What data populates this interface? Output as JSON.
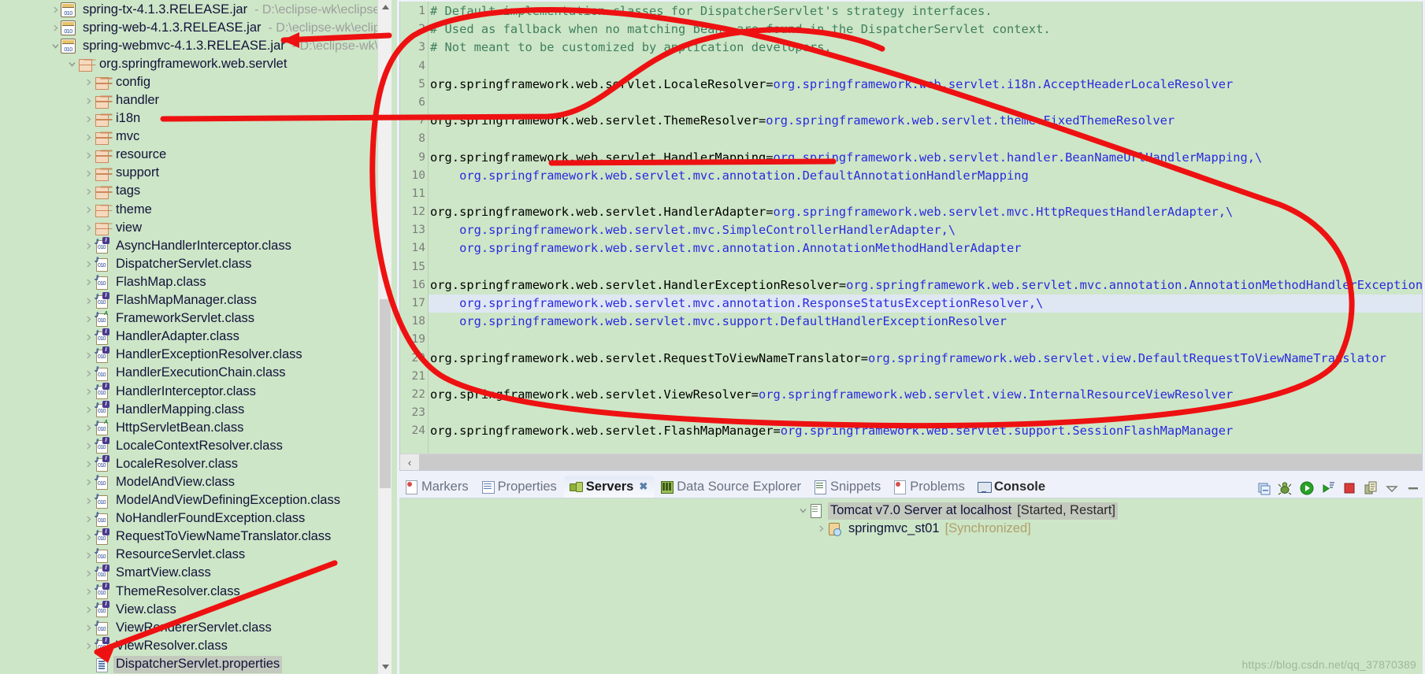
{
  "explorer": {
    "name": "package-explorer",
    "items": [
      {
        "indent": 1,
        "twisty": "collapsed",
        "icon": "jar-icon",
        "label": "spring-tx-4.1.3.RELEASE.jar",
        "path": "- D:\\eclipse-wk\\eclipse-c"
      },
      {
        "indent": 1,
        "twisty": "collapsed",
        "icon": "jar-icon",
        "label": "spring-web-4.1.3.RELEASE.jar",
        "path": "- D:\\eclipse-wk\\eclipse"
      },
      {
        "indent": 1,
        "twisty": "expanded",
        "icon": "jar-icon",
        "label": "spring-webmvc-4.1.3.RELEASE.jar",
        "path": "- D:\\eclipse-wk\\ec"
      },
      {
        "indent": 2,
        "twisty": "expanded",
        "icon": "package-icon",
        "label": "org.springframework.web.servlet",
        "path": ""
      },
      {
        "indent": 3,
        "twisty": "collapsed",
        "icon": "package-icon",
        "label": "config",
        "path": ""
      },
      {
        "indent": 3,
        "twisty": "collapsed",
        "icon": "package-icon",
        "label": "handler",
        "path": ""
      },
      {
        "indent": 3,
        "twisty": "collapsed",
        "icon": "package-icon",
        "label": "i18n",
        "path": ""
      },
      {
        "indent": 3,
        "twisty": "collapsed",
        "icon": "package-icon",
        "label": "mvc",
        "path": ""
      },
      {
        "indent": 3,
        "twisty": "collapsed",
        "icon": "package-icon",
        "label": "resource",
        "path": ""
      },
      {
        "indent": 3,
        "twisty": "collapsed",
        "icon": "package-icon",
        "label": "support",
        "path": ""
      },
      {
        "indent": 3,
        "twisty": "collapsed",
        "icon": "package-icon",
        "label": "tags",
        "path": ""
      },
      {
        "indent": 3,
        "twisty": "collapsed",
        "icon": "package-icon",
        "label": "theme",
        "path": ""
      },
      {
        "indent": 3,
        "twisty": "collapsed",
        "icon": "package-icon",
        "label": "view",
        "path": ""
      },
      {
        "indent": 3,
        "twisty": "collapsed",
        "icon": "interface-class-icon",
        "label": "AsyncHandlerInterceptor.class",
        "path": ""
      },
      {
        "indent": 3,
        "twisty": "collapsed",
        "icon": "class-icon",
        "label": "DispatcherServlet.class",
        "path": ""
      },
      {
        "indent": 3,
        "twisty": "collapsed",
        "icon": "class-icon",
        "label": "FlashMap.class",
        "path": ""
      },
      {
        "indent": 3,
        "twisty": "collapsed",
        "icon": "interface-class-icon",
        "label": "FlashMapManager.class",
        "path": ""
      },
      {
        "indent": 3,
        "twisty": "collapsed",
        "icon": "abstract-class-icon",
        "label": "FrameworkServlet.class",
        "path": ""
      },
      {
        "indent": 3,
        "twisty": "collapsed",
        "icon": "interface-class-icon",
        "label": "HandlerAdapter.class",
        "path": ""
      },
      {
        "indent": 3,
        "twisty": "collapsed",
        "icon": "interface-class-icon",
        "label": "HandlerExceptionResolver.class",
        "path": ""
      },
      {
        "indent": 3,
        "twisty": "collapsed",
        "icon": "class-icon",
        "label": "HandlerExecutionChain.class",
        "path": ""
      },
      {
        "indent": 3,
        "twisty": "collapsed",
        "icon": "interface-class-icon",
        "label": "HandlerInterceptor.class",
        "path": ""
      },
      {
        "indent": 3,
        "twisty": "collapsed",
        "icon": "interface-class-icon",
        "label": "HandlerMapping.class",
        "path": ""
      },
      {
        "indent": 3,
        "twisty": "collapsed",
        "icon": "abstract-class-icon",
        "label": "HttpServletBean.class",
        "path": ""
      },
      {
        "indent": 3,
        "twisty": "collapsed",
        "icon": "interface-class-icon",
        "label": "LocaleContextResolver.class",
        "path": ""
      },
      {
        "indent": 3,
        "twisty": "collapsed",
        "icon": "interface-class-icon",
        "label": "LocaleResolver.class",
        "path": ""
      },
      {
        "indent": 3,
        "twisty": "collapsed",
        "icon": "class-icon",
        "label": "ModelAndView.class",
        "path": ""
      },
      {
        "indent": 3,
        "twisty": "collapsed",
        "icon": "class-icon",
        "label": "ModelAndViewDefiningException.class",
        "path": ""
      },
      {
        "indent": 3,
        "twisty": "collapsed",
        "icon": "class-icon",
        "label": "NoHandlerFoundException.class",
        "path": ""
      },
      {
        "indent": 3,
        "twisty": "collapsed",
        "icon": "interface-class-icon",
        "label": "RequestToViewNameTranslator.class",
        "path": ""
      },
      {
        "indent": 3,
        "twisty": "collapsed",
        "icon": "class-icon",
        "label": "ResourceServlet.class",
        "path": ""
      },
      {
        "indent": 3,
        "twisty": "collapsed",
        "icon": "interface-class-icon",
        "label": "SmartView.class",
        "path": ""
      },
      {
        "indent": 3,
        "twisty": "collapsed",
        "icon": "interface-class-icon",
        "label": "ThemeResolver.class",
        "path": ""
      },
      {
        "indent": 3,
        "twisty": "collapsed",
        "icon": "interface-class-icon",
        "label": "View.class",
        "path": ""
      },
      {
        "indent": 3,
        "twisty": "collapsed",
        "icon": "class-icon",
        "label": "ViewRendererServlet.class",
        "path": ""
      },
      {
        "indent": 3,
        "twisty": "collapsed",
        "icon": "interface-class-icon",
        "label": "ViewResolver.class",
        "path": ""
      },
      {
        "indent": 3,
        "twisty": "none",
        "icon": "properties-file-icon",
        "label": "DispatcherServlet.properties",
        "path": "",
        "selected": true
      }
    ]
  },
  "editor": {
    "name": "dispatcherservlet-properties-editor",
    "highlighted_line": 17,
    "lines": [
      {
        "n": 1,
        "segments": [
          {
            "t": "# Default implementation classes for DispatcherServlet's strategy interfaces.",
            "c": "cmt"
          }
        ]
      },
      {
        "n": 2,
        "segments": [
          {
            "t": "# Used as fallback when no matching beans are found in the DispatcherServlet context.",
            "c": "cmt"
          }
        ]
      },
      {
        "n": 3,
        "segments": [
          {
            "t": "# Not meant to be customized by application developers.",
            "c": "cmt"
          }
        ]
      },
      {
        "n": 4,
        "segments": []
      },
      {
        "n": 5,
        "segments": [
          {
            "t": "org.springframework.web.servlet.LocaleResolver=",
            "c": "key"
          },
          {
            "t": "org.springframework.web.servlet.i18n.AcceptHeaderLocaleResolver",
            "c": "val"
          }
        ]
      },
      {
        "n": 6,
        "segments": []
      },
      {
        "n": 7,
        "segments": [
          {
            "t": "org.springframework.web.servlet.ThemeResolver=",
            "c": "key"
          },
          {
            "t": "org.springframework.web.servlet.theme.FixedThemeResolver",
            "c": "val"
          }
        ]
      },
      {
        "n": 8,
        "segments": []
      },
      {
        "n": 9,
        "segments": [
          {
            "t": "org.springframework.web.servlet.HandlerMapping=",
            "c": "key"
          },
          {
            "t": "org.springframework.web.servlet.handler.BeanNameUrlHandlerMapping,\\",
            "c": "val"
          }
        ]
      },
      {
        "n": 10,
        "segments": [
          {
            "t": "    org.springframework.web.servlet.mvc.annotation.DefaultAnnotationHandlerMapping",
            "c": "val"
          }
        ]
      },
      {
        "n": 11,
        "segments": []
      },
      {
        "n": 12,
        "segments": [
          {
            "t": "org.springframework.web.servlet.HandlerAdapter=",
            "c": "key"
          },
          {
            "t": "org.springframework.web.servlet.mvc.HttpRequestHandlerAdapter,\\",
            "c": "val"
          }
        ]
      },
      {
        "n": 13,
        "segments": [
          {
            "t": "    org.springframework.web.servlet.mvc.SimpleControllerHandlerAdapter,\\",
            "c": "val"
          }
        ]
      },
      {
        "n": 14,
        "segments": [
          {
            "t": "    org.springframework.web.servlet.mvc.annotation.AnnotationMethodHandlerAdapter",
            "c": "val"
          }
        ]
      },
      {
        "n": 15,
        "segments": []
      },
      {
        "n": 16,
        "segments": [
          {
            "t": "org.springframework.web.servlet.HandlerExceptionResolver=",
            "c": "key"
          },
          {
            "t": "org.springframework.web.servlet.mvc.annotation.AnnotationMethodHandlerExceptionResolver,\\",
            "c": "val"
          }
        ]
      },
      {
        "n": 17,
        "segments": [
          {
            "t": "    org.springframework.web.servlet.mvc.annotation.ResponseStatusExceptionResolver,\\",
            "c": "val"
          }
        ]
      },
      {
        "n": 18,
        "segments": [
          {
            "t": "    org.springframework.web.servlet.mvc.support.DefaultHandlerExceptionResolver",
            "c": "val"
          }
        ]
      },
      {
        "n": 19,
        "segments": []
      },
      {
        "n": 20,
        "segments": [
          {
            "t": "org.springframework.web.servlet.RequestToViewNameTranslator=",
            "c": "key"
          },
          {
            "t": "org.springframework.web.servlet.view.DefaultRequestToViewNameTranslator",
            "c": "val"
          }
        ]
      },
      {
        "n": 21,
        "segments": []
      },
      {
        "n": 22,
        "segments": [
          {
            "t": "org.springframework.web.servlet.ViewResolver=",
            "c": "key"
          },
          {
            "t": "org.springframework.web.servlet.view.InternalResourceViewResolver",
            "c": "val"
          }
        ]
      },
      {
        "n": 23,
        "segments": []
      },
      {
        "n": 24,
        "segments": [
          {
            "t": "org.springframework.web.servlet.FlashMapManager=",
            "c": "key"
          },
          {
            "t": "org.springframework.web.servlet.support.SessionFlashMapManager",
            "c": "val"
          }
        ]
      }
    ]
  },
  "bottom_panel": {
    "name": "servers-view",
    "tabs": [
      {
        "label": "Markers",
        "icon": "marker-icon",
        "active": false,
        "closable": false
      },
      {
        "label": "Properties",
        "icon": "properties-icon",
        "active": false,
        "closable": false
      },
      {
        "label": "Servers",
        "icon": "servers-icon",
        "active": true,
        "closable": true
      },
      {
        "label": "Data Source Explorer",
        "icon": "data-source-icon",
        "active": false,
        "closable": false
      },
      {
        "label": "Snippets",
        "icon": "snippets-icon",
        "active": false,
        "closable": false
      },
      {
        "label": "Problems",
        "icon": "problems-icon",
        "active": false,
        "closable": false
      },
      {
        "label": "Console",
        "icon": "console-icon",
        "active": false,
        "closable": false,
        "bold": true
      }
    ],
    "toolbar_icons": [
      "new-server-icon",
      "debug-icon",
      "start-icon",
      "profile-icon",
      "stop-icon",
      "publish-icon",
      "view-menu-icon",
      "minimize-icon"
    ],
    "tree": [
      {
        "indent": 0,
        "twisty": "expanded",
        "icon": "server-icon",
        "label": "Tomcat v7.0 Server at localhost",
        "suffix": "[Started, Restart]",
        "selected": true
      },
      {
        "indent": 1,
        "twisty": "collapsed",
        "icon": "module-icon",
        "label": "springmvc_st01",
        "suffix": "[Synchronized]",
        "selected": false
      }
    ]
  },
  "scrollbars": {
    "editor_h_left": "‹",
    "editor_h_right": "›",
    "tree_up": "^",
    "tree_down": "v"
  },
  "watermark": {
    "text": "https://blog.csdn.net/qq_37870389"
  },
  "colors": {
    "background": "#cde6c7",
    "annotation": "#ee1111",
    "selection": "#c3c9bd",
    "value_text": "#2a2ae0",
    "comment_text": "#3f7f5f",
    "highlight_line": "#dfe7f2"
  }
}
